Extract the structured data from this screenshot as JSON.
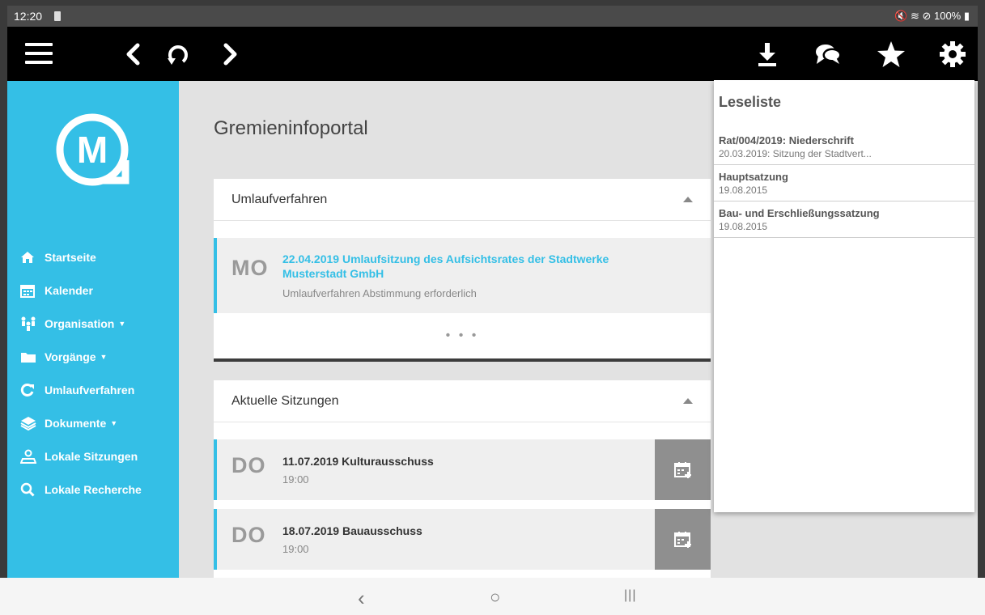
{
  "status_bar": {
    "time": "12:20",
    "right": "🔇 ≋ ⊘ 100% ▮"
  },
  "toolbar": {
    "menu_icon": "hamburger-icon",
    "back_icon": "chevron-left-icon",
    "reload_icon": "reload-icon",
    "forward_icon": "chevron-right-icon",
    "download_icon": "download-icon",
    "chat_icon": "chat-icon",
    "star_icon": "star-icon",
    "settings_icon": "gear-icon"
  },
  "sidebar": {
    "logo_letter": "M",
    "items": [
      {
        "label": "Startseite",
        "icon": "home-icon",
        "caret": ""
      },
      {
        "label": "Kalender",
        "icon": "calendar-icon",
        "caret": ""
      },
      {
        "label": "Organisation",
        "icon": "people-icon",
        "caret": "▼"
      },
      {
        "label": "Vorgänge",
        "icon": "folder-icon",
        "caret": "▼"
      },
      {
        "label": "Umlaufverfahren",
        "icon": "refresh-icon",
        "caret": ""
      },
      {
        "label": "Dokumente",
        "icon": "layers-icon",
        "caret": "▼"
      },
      {
        "label": "Lokale Sitzungen",
        "icon": "map-person-icon",
        "caret": ""
      },
      {
        "label": "Lokale Recherche",
        "icon": "search-icon",
        "caret": ""
      }
    ]
  },
  "main": {
    "title": "Gremieninfoportal",
    "umlauf": {
      "heading": "Umlaufverfahren",
      "entry": {
        "day": "MO",
        "title": "22.04.2019 Umlaufsitzung des Aufsichtsrates der Stadtwerke Musterstadt GmbH",
        "sub": "Umlaufverfahren Abstimmung erforderlich"
      },
      "more": "• • •"
    },
    "sitzungen": {
      "heading": "Aktuelle Sitzungen",
      "entries": [
        {
          "day": "DO",
          "title": "11.07.2019 Kulturausschuss",
          "time": "19:00"
        },
        {
          "day": "DO",
          "title": "18.07.2019 Bauausschuss",
          "time": "19:00"
        }
      ]
    }
  },
  "leseliste": {
    "heading": "Leseliste",
    "items": [
      {
        "title": "Rat/004/2019: Niederschrift",
        "sub": "20.03.2019: Sitzung der Stadtvert..."
      },
      {
        "title": "Hauptsatzung",
        "sub": "19.08.2015"
      },
      {
        "title": "Bau- und Erschließungssatzung",
        "sub": "19.08.2015"
      }
    ]
  },
  "android_nav": {
    "back": "‹",
    "home": "○",
    "recents": "|||"
  },
  "colors": {
    "accent": "#34bfe6",
    "toolbar": "#000000",
    "background": "#e2e2e2"
  }
}
